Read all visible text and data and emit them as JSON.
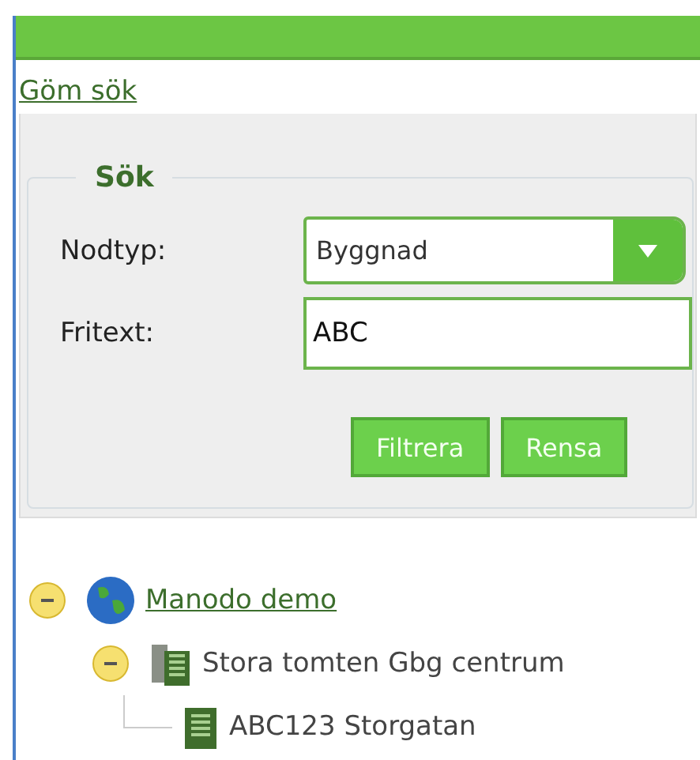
{
  "toggle_link": "Göm sök",
  "search": {
    "legend": "Sök",
    "node_type": {
      "label": "Nodtyp:",
      "value": "Byggnad"
    },
    "free_text": {
      "label": "Fritext:",
      "value": "ABC"
    },
    "buttons": [
      "Filtrera",
      "Rensa"
    ]
  },
  "tree": [
    {
      "label": "Manodo demo",
      "kind": "globe",
      "link": true,
      "expanded": true,
      "children": [
        {
          "label": "Stora tomten Gbg centrum",
          "kind": "site",
          "link": false,
          "expanded": true,
          "children": [
            {
              "label": "ABC123 Storgatan",
              "kind": "building",
              "link": false
            }
          ]
        }
      ]
    }
  ]
}
